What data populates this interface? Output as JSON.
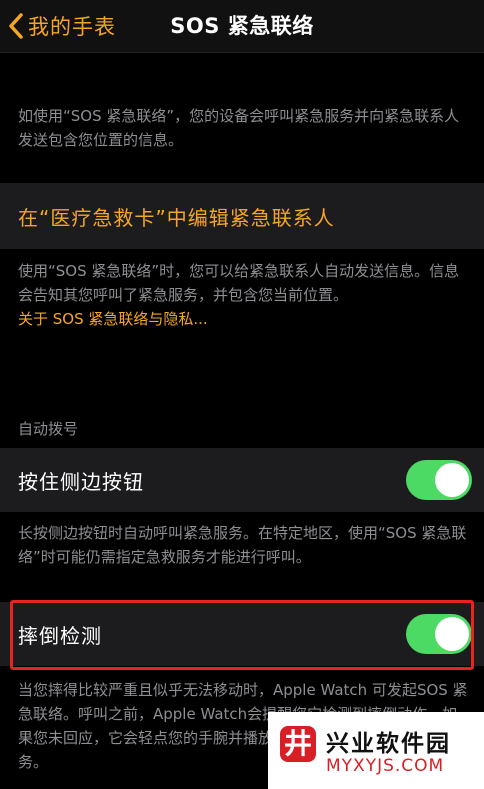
{
  "nav": {
    "back_label": "我的手表",
    "title": "SOS 紧急联络"
  },
  "intro_note": "如使用“SOS 紧急联络”，您的设备会呼叫紧急服务并向紧急联系人发送包含您位置的信息。",
  "medical_id": {
    "link_label": "在“医疗急救卡”中编辑紧急联系人",
    "note": "使用“SOS 紧急联络”时，您可以给紧急联系人自动发送信息。信息会告知其您呼叫了紧急服务，并包含您当前位置。",
    "privacy_link": "关于 SOS 紧急联络与隐私..."
  },
  "auto_call": {
    "header": "自动拨号",
    "hold_side_button": {
      "label": "按住侧边按钮",
      "on": true,
      "note": "长按侧边按钮时自动呼叫紧急服务。在特定地区，使用“SOS 紧急联络”时可能仍需指定急救服务才能进行呼叫。"
    }
  },
  "fall_detection": {
    "label": "摔倒检测",
    "on": true,
    "note": "当您摔得比较严重且似乎无法移动时，Apple Watch 可发起SOS 紧急联络。呼叫之前，Apple Watch会提醒您它检测到摔倒动作。如果您未回应，它会轻点您的手腕并播放提示音，之后再呼叫紧急服务。"
  },
  "watermark": {
    "logo_glyph": "井",
    "title": "兴业软件园",
    "url": "MYXYJS.COM"
  },
  "colors": {
    "accent": "#f5a623",
    "switch_on": "#4cd964",
    "highlight": "#e8241f"
  }
}
